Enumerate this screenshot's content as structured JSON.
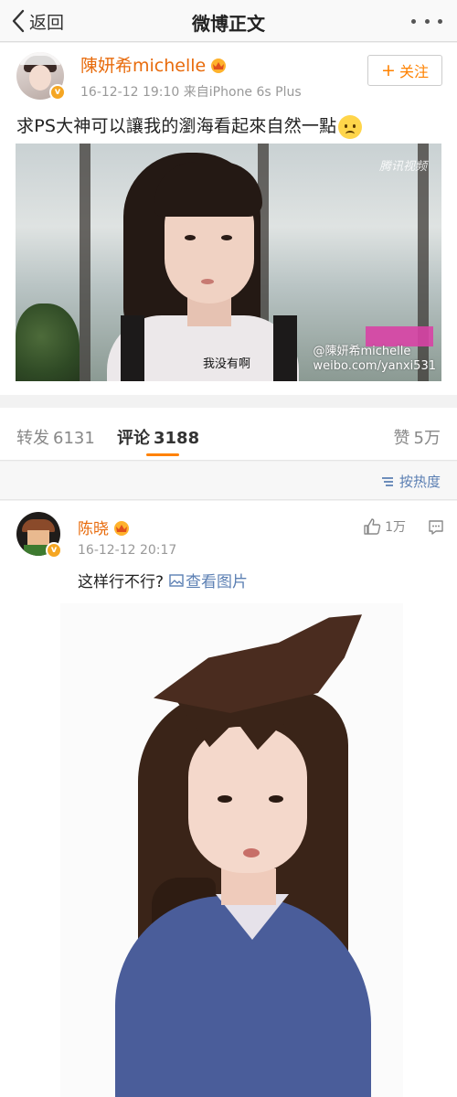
{
  "navbar": {
    "back_label": "返回",
    "title": "微博正文"
  },
  "post": {
    "author": "陳妍希michelle",
    "meta": "16-12-12 19:10 来自iPhone 6s Plus",
    "follow_label": "关注",
    "text": "求PS大神可以讓我的瀏海看起來自然一點",
    "image": {
      "subtitle": "我没有啊",
      "watermark_top": "腾讯视频",
      "watermark_handle": "@陳妍希michelle",
      "watermark_url": "weibo.com/yanxi531"
    }
  },
  "stats": {
    "repost": {
      "label": "转发",
      "count": "6131"
    },
    "comment": {
      "label": "评论",
      "count": "3188"
    },
    "like": {
      "label": "赞",
      "count": "5万"
    }
  },
  "sort": {
    "label": "按热度"
  },
  "comment": {
    "author": "陈晓",
    "time": "16-12-12 20:17",
    "likes": "1万",
    "text": "这样行不行?",
    "link_label": "查看图片"
  },
  "colors": {
    "accent": "#ff8200",
    "author_name": "#e86b0c",
    "link": "#5b7fb3",
    "verified": "#f5a623"
  }
}
